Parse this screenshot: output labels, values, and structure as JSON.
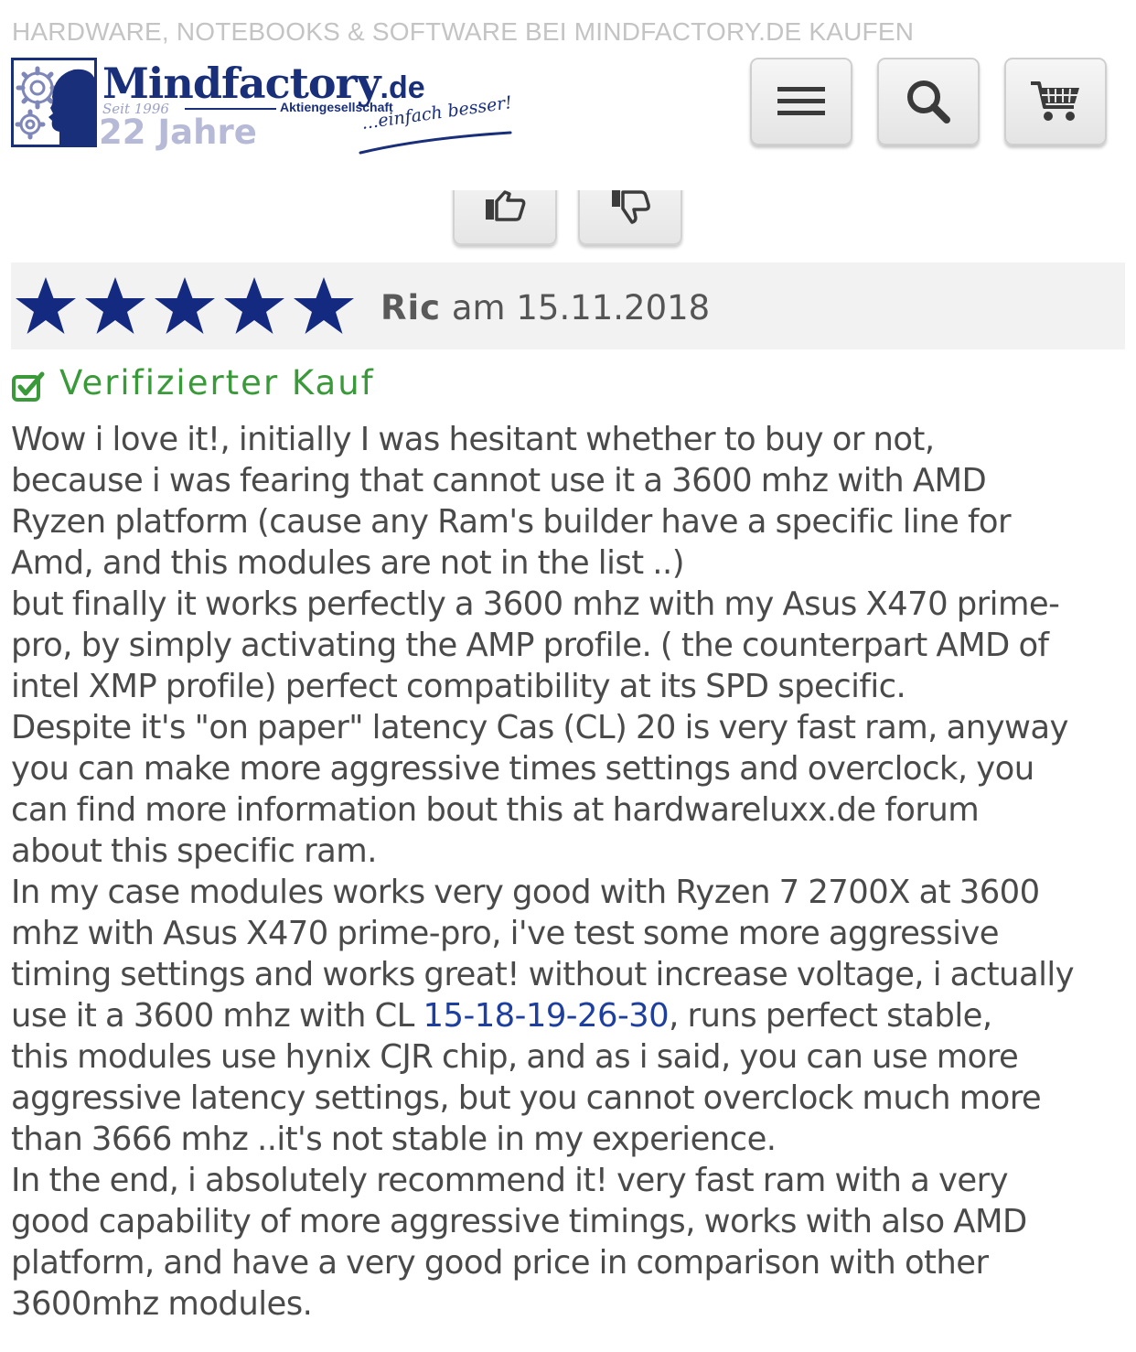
{
  "header": {
    "tagline": "HARDWARE, NOTEBOOKS & SOFTWARE BEI MINDFACTORY.DE KAUFEN",
    "logo": {
      "name": "Mindfactory",
      "tld": ".de",
      "since": "Seit 1996",
      "company_type": "Aktiengesellschaft",
      "anniversary": "22 Jahre",
      "slogan": "...einfach besser!"
    },
    "buttons": {
      "menu_icon": "hamburger-menu-icon",
      "search_icon": "search-icon",
      "cart_icon": "shopping-cart-icon"
    }
  },
  "votes": {
    "up_icon": "thumbs-up-icon",
    "down_icon": "thumbs-down-icon"
  },
  "review": {
    "rating": 5,
    "rating_max": 5,
    "author": "Ric",
    "date_prefix": "am",
    "date": "15.11.2018",
    "verified_label": "Verifizierter Kauf",
    "colors": {
      "stars": "#142a80",
      "verified": "#3a9a3a",
      "link": "#1e3f9e"
    },
    "body_lines": [
      "Wow i love it!, initially I was hesitant whether to buy or not,",
      "because i was fearing that cannot use it a 3600 mhz with AMD",
      "Ryzen platform (cause any Ram's builder have a specific line for",
      "Amd, and this modules are not in the list ..)",
      "but finally it works perfectly a 3600 mhz with my Asus X470 prime-",
      "pro, by simply activating the AMP profile. ( the counterpart AMD of",
      "intel XMP profile) perfect compatibility at its SPD specific.",
      "Despite it's \"on paper\" latency Cas (CL) 20 is very fast ram, anyway",
      "you can make more aggressive times settings and overclock, you",
      "can find more information bout this at hardwareluxx.de forum",
      "about this specific ram.",
      "In my case modules works very good with Ryzen 7 2700X at 3600",
      "mhz with Asus X470 prime-pro, i've test some more aggressive",
      "timing settings and works great! without increase voltage, i actually"
    ],
    "timing_line": {
      "before": "use it a 3600 mhz with CL ",
      "link": "15-18-19-26-30",
      "after": ", runs perfect stable,"
    },
    "body_lines_end": [
      "this modules use hynix CJR chip, and as i said, you can use more",
      "aggressive latency settings, but you cannot overclock much more",
      "than 3666 mhz ..it's not stable in my experience.",
      "In the end, i absolutely recommend it! very fast ram with a very",
      "good capability of more aggressive timings, works with also AMD",
      "platform, and have a very good price in comparison with other",
      "3600mhz modules."
    ]
  }
}
